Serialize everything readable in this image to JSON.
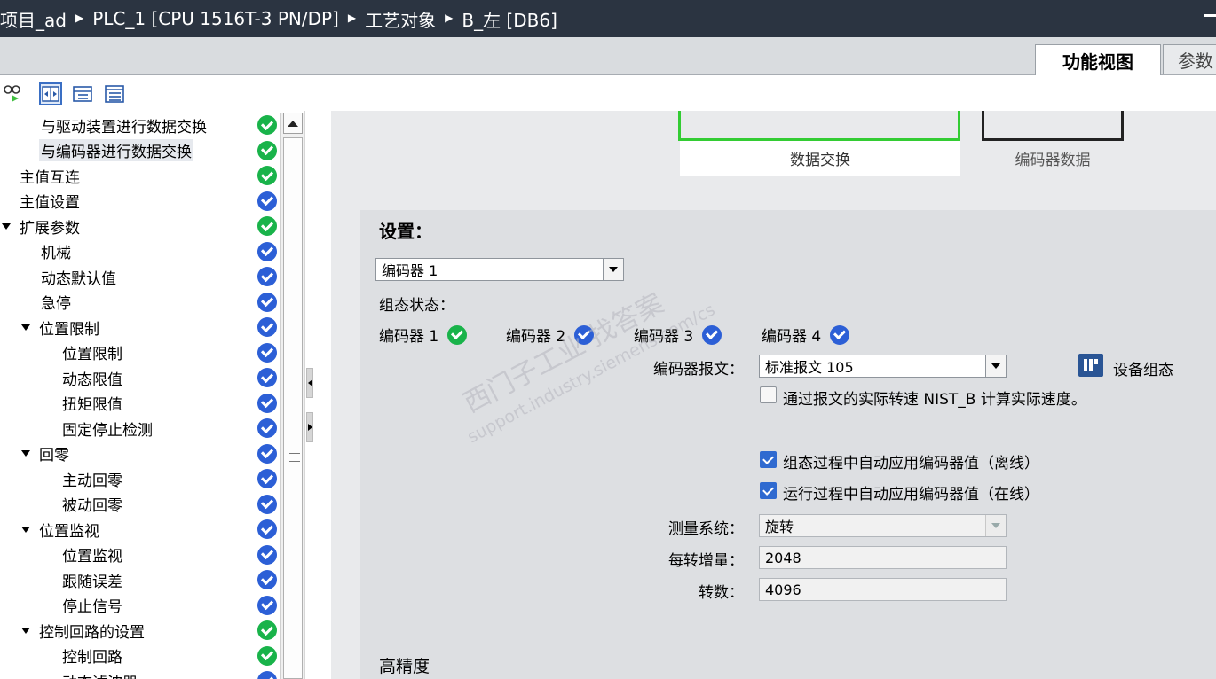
{
  "breadcrumb": [
    "项目_ad",
    "PLC_1 [CPU 1516T-3 PN/DP]",
    "工艺对象",
    "B_左 [DB6]"
  ],
  "view_tabs": {
    "functional": "功能视图",
    "parameters": "参数"
  },
  "nav": {
    "items": [
      {
        "label": "与驱动装置进行数据交换",
        "indent": 2,
        "status": "green"
      },
      {
        "label": "与编码器进行数据交换",
        "indent": 2,
        "status": "green",
        "selected": true
      },
      {
        "label": "主值互连",
        "indent": 1,
        "status": "green"
      },
      {
        "label": "主值设置",
        "indent": 1,
        "status": "blue"
      },
      {
        "label": "扩展参数",
        "indent": 0,
        "status": "green",
        "expanded": true
      },
      {
        "label": "机械",
        "indent": 2,
        "status": "blue"
      },
      {
        "label": "动态默认值",
        "indent": 2,
        "status": "blue"
      },
      {
        "label": "急停",
        "indent": 2,
        "status": "blue"
      },
      {
        "label": "位置限制",
        "indent": 1,
        "status": "blue",
        "expanded": true
      },
      {
        "label": "位置限制",
        "indent": 3,
        "status": "blue"
      },
      {
        "label": "动态限值",
        "indent": 3,
        "status": "blue"
      },
      {
        "label": "扭矩限值",
        "indent": 3,
        "status": "blue"
      },
      {
        "label": "固定停止检测",
        "indent": 3,
        "status": "blue"
      },
      {
        "label": "回零",
        "indent": 1,
        "status": "blue",
        "expanded": true
      },
      {
        "label": "主动回零",
        "indent": 3,
        "status": "blue"
      },
      {
        "label": "被动回零",
        "indent": 3,
        "status": "blue"
      },
      {
        "label": "位置监视",
        "indent": 1,
        "status": "blue",
        "expanded": true
      },
      {
        "label": "位置监视",
        "indent": 3,
        "status": "blue"
      },
      {
        "label": "跟随误差",
        "indent": 3,
        "status": "blue"
      },
      {
        "label": "停止信号",
        "indent": 3,
        "status": "blue"
      },
      {
        "label": "控制回路的设置",
        "indent": 1,
        "status": "green",
        "expanded": true
      },
      {
        "label": "控制回路",
        "indent": 3,
        "status": "green"
      },
      {
        "label": "动态滤波器",
        "indent": 3,
        "status": "blue"
      }
    ]
  },
  "diagram": {
    "data_exchange": "数据交换",
    "encoder_data": "编码器数据"
  },
  "settings": {
    "heading": "设置：",
    "encoder_select": "编码器 1",
    "config_status_label": "组态状态：",
    "encoders": [
      {
        "label": "编码器 1",
        "status": "green"
      },
      {
        "label": "编码器 2",
        "status": "blue"
      },
      {
        "label": "编码器 3",
        "status": "blue"
      },
      {
        "label": "编码器 4",
        "status": "blue"
      }
    ],
    "telegram_label": "编码器报文：",
    "telegram_value": "标准报文 105",
    "device_config": "设备组态",
    "nist_checkbox": "通过报文的实际转速 NIST_B 计算实际速度。",
    "auto_offline": "组态过程中自动应用编码器值（离线）",
    "auto_online": "运行过程中自动应用编码器值（在线）",
    "measuring_system_label": "测量系统：",
    "measuring_system_value": "旋转",
    "increments_label": "每转增量：",
    "increments_value": "2048",
    "revolutions_label": "转数：",
    "revolutions_value": "4096",
    "high_precision": "高精度"
  },
  "watermark": {
    "text1": "西门子工业  找答案",
    "text2": "support.industry.siemens.com/cs"
  },
  "colors": {
    "titlebar": "#2b3441",
    "ok_green": "#19b34a",
    "ok_blue": "#2c5fd6",
    "diagram_green": "#33cc33"
  }
}
